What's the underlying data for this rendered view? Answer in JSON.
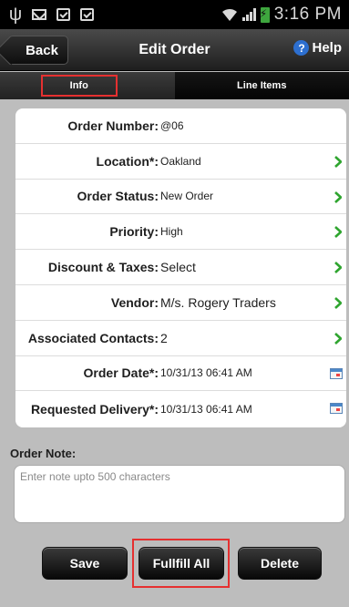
{
  "status_bar": {
    "time": "3:16 PM",
    "icons": [
      "usb-icon",
      "mail-icon",
      "bag-check-icon",
      "bag-check-icon",
      "wifi-icon",
      "signal-icon",
      "battery-charging-icon"
    ],
    "battery_color": "#3ea63e"
  },
  "header": {
    "back_label": "Back",
    "title": "Edit Order",
    "help_label": "Help",
    "help_icon_glyph": "?",
    "help_icon_color": "#2d6fd0"
  },
  "tabs": [
    {
      "label": "Info",
      "selected": true
    },
    {
      "label": "Line Items",
      "selected": false
    }
  ],
  "fields": [
    {
      "label": "Order Number:",
      "value": "@06",
      "action": "none"
    },
    {
      "label": "Location*:",
      "value": "Oakland",
      "action": "chevron"
    },
    {
      "label": "Order Status:",
      "value": "New Order",
      "action": "chevron"
    },
    {
      "label": "Priority:",
      "value": "High",
      "action": "chevron"
    },
    {
      "label": "Discount & Taxes:",
      "value": "Select",
      "action": "chevron"
    },
    {
      "label": "Vendor:",
      "value": "M/s. Rogery Traders",
      "action": "chevron"
    },
    {
      "label": "Associated Contacts:",
      "value": "2",
      "action": "chevron"
    },
    {
      "label": "Order Date*:",
      "value": "10/31/13 06:41 AM",
      "action": "calendar"
    },
    {
      "label": "Requested Delivery*:",
      "value": "10/31/13 06:41 AM",
      "action": "calendar"
    }
  ],
  "note": {
    "label": "Order Note:",
    "placeholder": "Enter note upto 500 characters",
    "value": ""
  },
  "buttons": {
    "save": "Save",
    "fulfill": "Fullfill All",
    "delete": "Delete"
  },
  "colors": {
    "chevron": "#2fa52f",
    "highlight": "#e53030"
  }
}
